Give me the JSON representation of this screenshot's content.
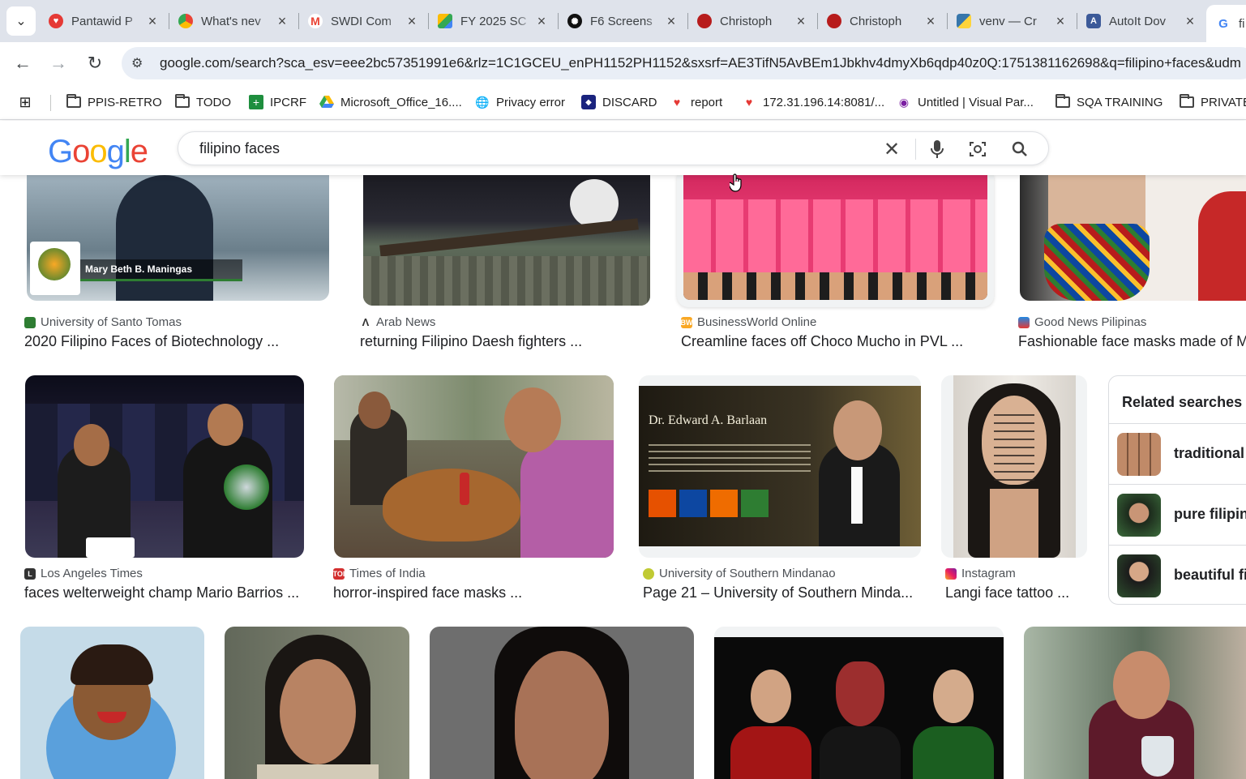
{
  "tabs": [
    {
      "title": "Pantawid P",
      "favicon": "heart",
      "color": "#e53935"
    },
    {
      "title": "What's nev",
      "favicon": "chrome",
      "color": "#34a853"
    },
    {
      "title": "SWDI Com",
      "favicon": "gmail",
      "color": "#ea4335"
    },
    {
      "title": "FY 2025 SC",
      "favicon": "drive",
      "color": "#fbbc04"
    },
    {
      "title": "F6 Screens",
      "favicon": "openai",
      "color": "#111111"
    },
    {
      "title": "Christoph",
      "favicon": "avatar-red",
      "color": "#b71c1c"
    },
    {
      "title": "Christoph",
      "favicon": "avatar-red",
      "color": "#b71c1c"
    },
    {
      "title": "venv — Cr",
      "favicon": "python",
      "color": "#3776ab"
    },
    {
      "title": "AutoIt Dov",
      "favicon": "autoit",
      "color": "#3c5a99"
    },
    {
      "title": "fi",
      "favicon": "google",
      "color": "#4285f4"
    }
  ],
  "url": "google.com/search?sca_esv=eee2bc57351991e6&rlz=1C1GCEU_enPH1152PH1152&sxsrf=AE3TifN5AvBEm1Jbkhv4dmyXb6qdp40z0Q:1751381162698&q=filipino+faces&udm",
  "bookmarks": [
    {
      "label": "PPIS-RETRO",
      "icon": "folder"
    },
    {
      "label": "TODO",
      "icon": "folder"
    },
    {
      "label": "IPCRF",
      "icon": "plus-green"
    },
    {
      "label": "Microsoft_Office_16....",
      "icon": "drive"
    },
    {
      "label": "Privacy error",
      "icon": "globe"
    },
    {
      "label": "DISCARD",
      "icon": "shield"
    },
    {
      "label": "report",
      "icon": "heart"
    },
    {
      "label": "172.31.196.14:8081/...",
      "icon": "heart"
    },
    {
      "label": "Untitled | Visual Par...",
      "icon": "visual"
    },
    {
      "label": "SQA TRAINING",
      "icon": "folder"
    },
    {
      "label": "PRIVATE",
      "icon": "folder"
    }
  ],
  "search": {
    "query": "filipino faces"
  },
  "results": [
    {
      "source": "University of Santo Tomas",
      "title": "2020 Filipino Faces of Biotechnology ...",
      "caption": "Mary Beth B. Maningas"
    },
    {
      "source": "Arab News",
      "title": "returning Filipino Daesh fighters ..."
    },
    {
      "source": "BusinessWorld Online",
      "title": "Creamline faces off Choco Mucho in PVL ..."
    },
    {
      "source": "Good News Pilipinas",
      "title": "Fashionable face masks made of M"
    },
    {
      "source": "Los Angeles Times",
      "title": "faces welterweight champ Mario Barrios ..."
    },
    {
      "source": "Times of India",
      "title": "horror-inspired face masks ..."
    },
    {
      "source": "University of Southern Mindanao",
      "title": "Page 21 – University of Southern Minda...",
      "caption": "Dr. Edward A. Barlaan"
    },
    {
      "source": "Instagram",
      "title": "Langi face tattoo ..."
    }
  ],
  "related": {
    "heading": "Related searches",
    "items": [
      "traditional f",
      "pure filipino",
      "beautiful fil"
    ]
  }
}
